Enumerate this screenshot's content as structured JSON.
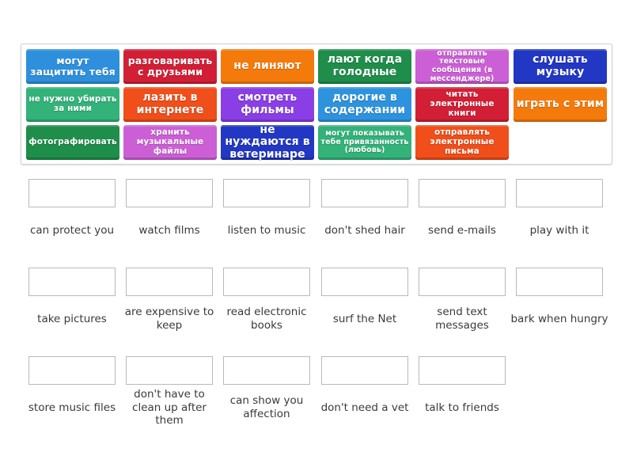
{
  "tile_bank": {
    "tiles": [
      {
        "text": "могут защитить тебя",
        "color": "#2e8fdc"
      },
      {
        "text": "разговаривать с друзьями",
        "color": "#d21f35"
      },
      {
        "text": "не линяют",
        "color": "#f57a0c"
      },
      {
        "text": "лают когда голодные",
        "color": "#1e8e4a"
      },
      {
        "text": "отправлять текстовые сообщения (в мессенджере)",
        "color": "#cc5fd6"
      },
      {
        "text": "слушать музыку",
        "color": "#2238c4"
      },
      {
        "text": "не нужно убирать за ними",
        "color": "#33b27a"
      },
      {
        "text": "лазить в интернете",
        "color": "#f04e1a"
      },
      {
        "text": "смотреть фильмы",
        "color": "#8a3ee6"
      },
      {
        "text": "дорогие в содержании",
        "color": "#2e93df"
      },
      {
        "text": "читать электронные книги",
        "color": "#d21f35"
      },
      {
        "text": "играть с этим",
        "color": "#f57a0c"
      },
      {
        "text": "фотографировать",
        "color": "#1e8e4a"
      },
      {
        "text": "хранить музыкальные файлы",
        "color": "#cc5fd6"
      },
      {
        "text": "не нуждаются в ветеринаре",
        "color": "#2238c4"
      },
      {
        "text": "могут показывать тебе привязанность (любовь)",
        "color": "#33b27a"
      },
      {
        "text": "отправлять электронные письма",
        "color": "#f04e1a"
      }
    ]
  },
  "targets": [
    {
      "label": "can protect you",
      "answer": ""
    },
    {
      "label": "watch films",
      "answer": ""
    },
    {
      "label": "listen to music",
      "answer": ""
    },
    {
      "label": "don't shed hair",
      "answer": ""
    },
    {
      "label": "send e-mails",
      "answer": ""
    },
    {
      "label": "play with it",
      "answer": ""
    },
    {
      "label": "take pictures",
      "answer": ""
    },
    {
      "label": "are expensive to keep",
      "answer": ""
    },
    {
      "label": "read electronic books",
      "answer": ""
    },
    {
      "label": "surf the Net",
      "answer": ""
    },
    {
      "label": "send text messages",
      "answer": ""
    },
    {
      "label": "bark when hungry",
      "answer": ""
    },
    {
      "label": "store music files",
      "answer": ""
    },
    {
      "label": "don't have to clean up after them",
      "answer": ""
    },
    {
      "label": "can show you affection",
      "answer": ""
    },
    {
      "label": "don't need a vet",
      "answer": ""
    },
    {
      "label": "talk to friends",
      "answer": ""
    }
  ]
}
